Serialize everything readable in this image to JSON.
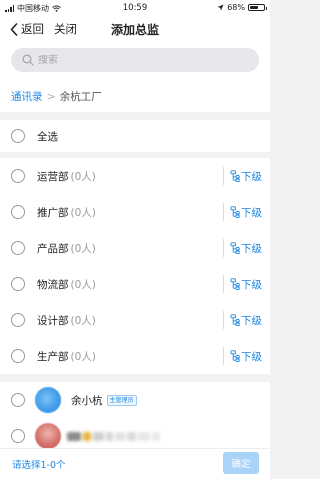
{
  "status_bar": {
    "carrier": "中国移动",
    "time": "10:59",
    "battery_text": "68%",
    "battery_level": 0.68
  },
  "nav": {
    "back_label": "返回",
    "close_label": "关闭",
    "title": "添加总监"
  },
  "search": {
    "placeholder": "搜索",
    "value": ""
  },
  "breadcrumb": {
    "root": "通讯录",
    "separator": ">",
    "current": "余杭工厂"
  },
  "select_all": {
    "label": "全选"
  },
  "departments": [
    {
      "name": "运营部",
      "count": "(0人)",
      "sub_label": "下级"
    },
    {
      "name": "推广部",
      "count": "(0人)",
      "sub_label": "下级"
    },
    {
      "name": "产品部",
      "count": "(0人)",
      "sub_label": "下级"
    },
    {
      "name": "物流部",
      "count": "(0人)",
      "sub_label": "下级"
    },
    {
      "name": "设计部",
      "count": "(0人)",
      "sub_label": "下级"
    },
    {
      "name": "生产部",
      "count": "(0人)",
      "sub_label": "下级"
    }
  ],
  "members": [
    {
      "name": "余小杭",
      "badge": "主管理员"
    }
  ],
  "footer": {
    "selection_hint": "请选择1-0个",
    "confirm_label": "确定"
  },
  "colors": {
    "accent": "#1e88e5",
    "confirm_disabled": "#a9d3f7",
    "background": "#f2f2f4"
  },
  "icons": {
    "back": "chevron-left-icon",
    "search": "search-icon",
    "subordinate": "org-tree-icon",
    "wifi": "wifi-icon",
    "location": "location-icon",
    "signal": "signal-icon",
    "battery": "battery-icon"
  }
}
